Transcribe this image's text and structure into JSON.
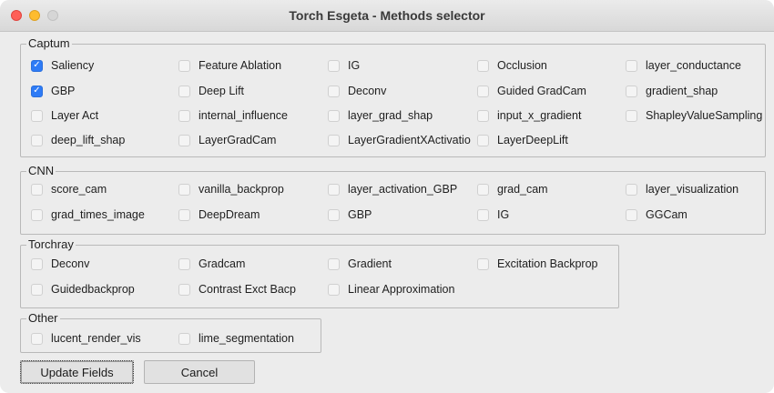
{
  "window": {
    "title": "Torch Esgeta - Methods selector"
  },
  "groups": {
    "captum": {
      "label": "Captum",
      "rows": [
        [
          {
            "label": "Saliency",
            "checked": true
          },
          {
            "label": "Feature Ablation",
            "checked": false
          },
          {
            "label": "IG",
            "checked": false
          },
          {
            "label": "Occlusion",
            "checked": false
          },
          {
            "label": "layer_conductance",
            "checked": false
          }
        ],
        [
          {
            "label": "GBP",
            "checked": true
          },
          {
            "label": "Deep Lift",
            "checked": false
          },
          {
            "label": "Deconv",
            "checked": false
          },
          {
            "label": "Guided GradCam",
            "checked": false
          },
          {
            "label": "gradient_shap",
            "checked": false
          }
        ],
        [
          {
            "label": "Layer Act",
            "checked": false
          },
          {
            "label": "internal_influence",
            "checked": false
          },
          {
            "label": "layer_grad_shap",
            "checked": false
          },
          {
            "label": "input_x_gradient",
            "checked": false
          },
          {
            "label": "ShapleyValueSampling",
            "checked": false
          }
        ],
        [
          {
            "label": "deep_lift_shap",
            "checked": false
          },
          {
            "label": "LayerGradCam",
            "checked": false
          },
          {
            "label": "LayerGradientXActivatio",
            "checked": false
          },
          {
            "label": "LayerDeepLift",
            "checked": false
          }
        ]
      ]
    },
    "cnn": {
      "label": "CNN",
      "rows": [
        [
          {
            "label": "score_cam",
            "checked": false
          },
          {
            "label": "vanilla_backprop",
            "checked": false
          },
          {
            "label": "layer_activation_GBP",
            "checked": false
          },
          {
            "label": "grad_cam",
            "checked": false
          },
          {
            "label": "layer_visualization",
            "checked": false
          }
        ],
        [
          {
            "label": "grad_times_image",
            "checked": false
          },
          {
            "label": "DeepDream",
            "checked": false
          },
          {
            "label": "GBP",
            "checked": false
          },
          {
            "label": "IG",
            "checked": false
          },
          {
            "label": "GGCam",
            "checked": false
          }
        ]
      ]
    },
    "torchray": {
      "label": "Torchray",
      "rows": [
        [
          {
            "label": "Deconv",
            "checked": false
          },
          {
            "label": "Gradcam",
            "checked": false
          },
          {
            "label": "Gradient",
            "checked": false
          },
          {
            "label": "Excitation Backprop",
            "checked": false
          }
        ],
        [
          {
            "label": "Guidedbackprop",
            "checked": false
          },
          {
            "label": "Contrast Exct Bacp",
            "checked": false
          },
          {
            "label": "Linear Approximation",
            "checked": false
          }
        ]
      ]
    },
    "other": {
      "label": "Other",
      "rows": [
        [
          {
            "label": "lucent_render_vis",
            "checked": false
          },
          {
            "label": "lime_segmentation",
            "checked": false
          }
        ]
      ]
    }
  },
  "buttons": {
    "update": "Update Fields",
    "cancel": "Cancel"
  },
  "colors": {
    "accent": "#2e7bf6",
    "window_bg": "#ececec"
  }
}
